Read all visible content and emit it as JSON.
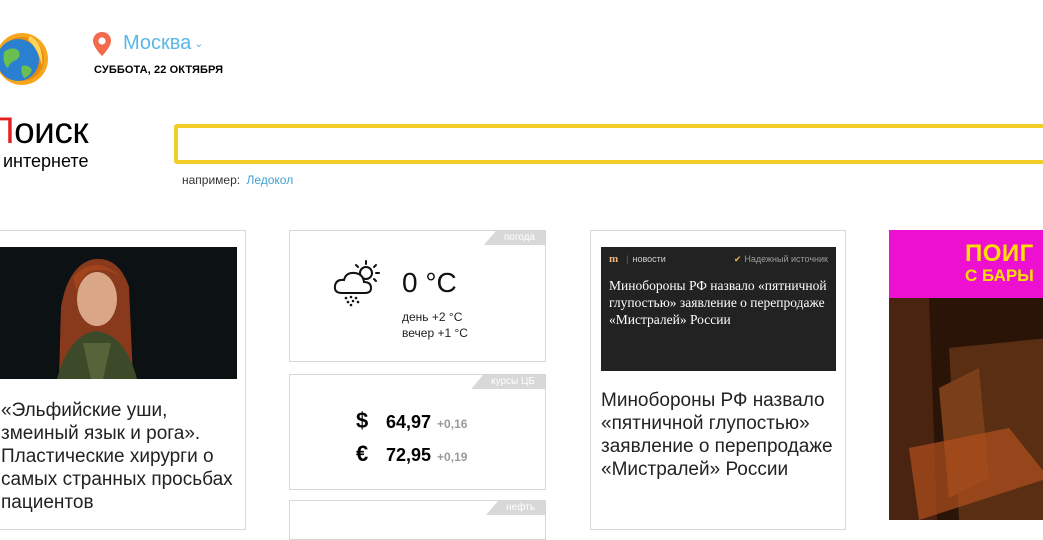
{
  "header": {
    "city": "Москва",
    "date": "СУББОТА, 22 ОКТЯБРЯ"
  },
  "search": {
    "brand_title_red": "П",
    "brand_title": "оиск",
    "brand_subtitle": "интернете",
    "input_value": "",
    "hint_label": "например:",
    "hint_link": "Ледокол"
  },
  "cards": {
    "story": {
      "title": "«Эльфийские уши, змеиный язык и рога». Пластические хирурги о самых странных просьбах пациентов"
    },
    "weather": {
      "tag": "погода",
      "temp": "0 °C",
      "day": "день +2 °C",
      "evening": "вечер +1 °C",
      "icon": "cloud-sun-snow-icon"
    },
    "currency": {
      "tag": "курсы ЦБ",
      "rates": [
        {
          "symbol": "$",
          "value": "64,97",
          "change": "+0,16"
        },
        {
          "symbol": "€",
          "value": "72,95",
          "change": "+0,19"
        }
      ]
    },
    "oil": {
      "tag": "нефть"
    },
    "news": {
      "source_mark": "m",
      "source_label": "новости",
      "trusted_label": "Надежный источник",
      "box_text": "Минобороны РФ назвало «пятничной глупостью» заявление о перепродаже «Мистралей» России",
      "title": "Минобороны РФ назвало «пятничной глупостью» заявление о перепродаже «Мистралей» России"
    },
    "ad": {
      "line1": "ПОИГ",
      "line2": "С БАРЫ"
    }
  },
  "colors": {
    "accent_yellow": "#f2cd28",
    "link_blue": "#3ea2d4",
    "city_blue": "#5bb7e5",
    "brand_red": "#e62020",
    "ad_magenta": "#ee10d0"
  }
}
